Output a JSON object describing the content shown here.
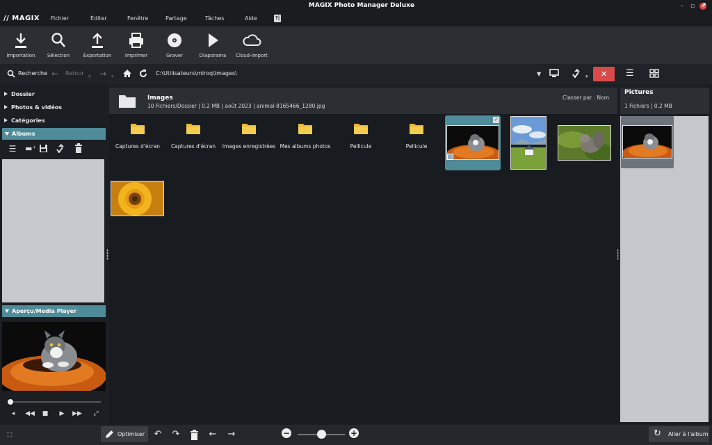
{
  "app": {
    "logo": "// MAGIX",
    "title": "MAGIX Photo Manager Deluxe",
    "menu": [
      "Fichier",
      "Éditer",
      "Fenêtre",
      "Partage",
      "Tâches",
      "Aide"
    ],
    "help_label": "?|"
  },
  "toolbar": {
    "items": [
      {
        "label": "Importation",
        "icon": "download-icon"
      },
      {
        "label": "Sélection",
        "icon": "search-icon"
      },
      {
        "label": "Exportation",
        "icon": "upload-icon"
      },
      {
        "label": "Imprimer",
        "icon": "printer-icon"
      },
      {
        "label": "Graver",
        "icon": "disc-icon"
      },
      {
        "label": "Diaporama",
        "icon": "play-icon"
      },
      {
        "label": "Cloud-Import",
        "icon": "cloud-icon"
      }
    ]
  },
  "addressbar": {
    "search_label": "Recherche",
    "back_label": "Retour",
    "path": "C:\\Utilisateurs\\mlroq\\Images\\"
  },
  "leftpanel": {
    "sections": [
      "Dossier",
      "Photos & vidéos",
      "Catégories"
    ],
    "albums_label": "Albums",
    "preview_label": "Aperçu/Media Player"
  },
  "center": {
    "folder_title": "Images",
    "folder_info": "10 Fichiers/Dossier | 0.2 MB | août 2023 | animal-8165466_1280.jpg",
    "sort_label": "Classer par : Nom",
    "folders": [
      "Captures d'écran",
      "Captures d'écran",
      "Images enregistrées",
      "Mes albums photos",
      "Pellicule",
      "Pellicule"
    ],
    "photos": [
      "cat-on-pumpkin",
      "house-on-meadow",
      "squirrel-in-grass",
      "sunflower"
    ]
  },
  "rightpanel": {
    "title": "Pictures",
    "info": "1 Fichiers | 0.2 MB"
  },
  "bottombar": {
    "optimise_label": "Optimiser",
    "goto_album_label": "Aller à l'album"
  },
  "colors": {
    "accent": "#4f8b98",
    "close_red": "#d94b4b"
  }
}
